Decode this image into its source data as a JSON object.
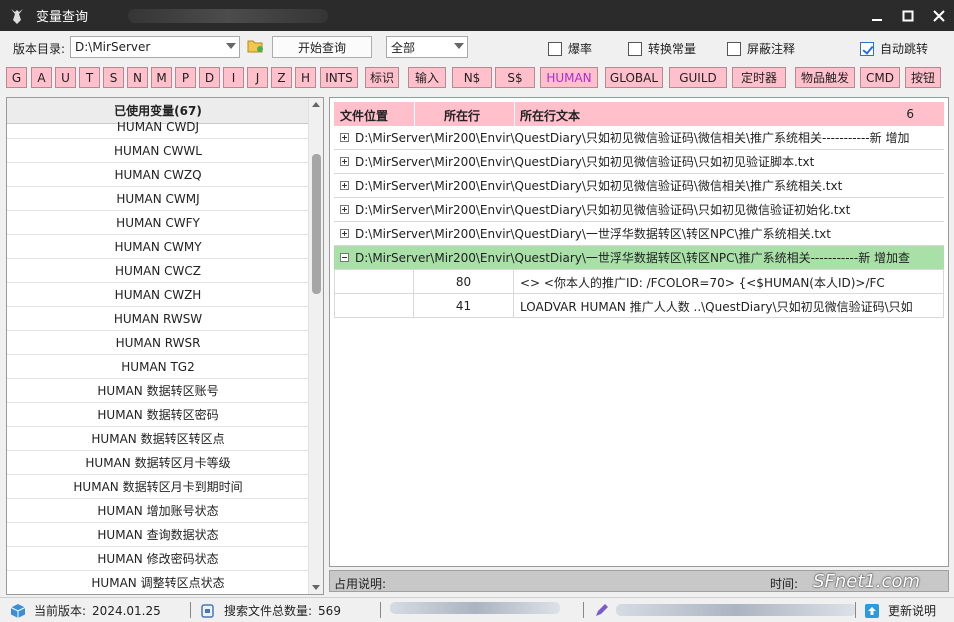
{
  "window": {
    "title": "变量查询"
  },
  "toolbar": {
    "dir_label": "版本目录:",
    "dir_value": "D:\\MirServer",
    "query_button": "开始查询",
    "scope_value": "全部",
    "checkboxes": [
      {
        "label": "爆率",
        "checked": false
      },
      {
        "label": "转换常量",
        "checked": false
      },
      {
        "label": "屏蔽注释",
        "checked": false
      },
      {
        "label": "自动跳转",
        "checked": true
      }
    ]
  },
  "var_buttons": [
    "G",
    "A",
    "U",
    "T",
    "S",
    "N",
    "M",
    "P",
    "D",
    "I",
    "J",
    "Z",
    "H",
    "INTS",
    "标识",
    "输入",
    "N$",
    "S$",
    "HUMAN",
    "GLOBAL",
    "GUILD",
    "定时器",
    "物品触发",
    "CMD",
    "按钮"
  ],
  "selected_var_button": "HUMAN",
  "left_panel": {
    "header": "已使用变量(67)",
    "items": [
      "HUMAN CWDJ",
      "HUMAN CWWL",
      "HUMAN CWZQ",
      "HUMAN CWMJ",
      "HUMAN CWFY",
      "HUMAN CWMY",
      "HUMAN CWCZ",
      "HUMAN CWZH",
      "HUMAN RWSW",
      "HUMAN RWSR",
      "HUMAN TG2",
      "HUMAN 数据转区账号",
      "HUMAN 数据转区密码",
      "HUMAN 数据转区转区点",
      "HUMAN 数据转区月卡等级",
      "HUMAN 数据转区月卡到期时间",
      "HUMAN 增加账号状态",
      "HUMAN 查询数据状态",
      "HUMAN 修改密码状态",
      "HUMAN 调整转区点状态"
    ]
  },
  "right_panel": {
    "col_file": "文件位置",
    "col_line": "所在行",
    "col_text": "所在行文本",
    "count": "6",
    "files": [
      {
        "path": "D:\\MirServer\\Mir200\\Envir\\QuestDiary\\只如初见微信验证码\\微信相关\\推广系统相关-----------新 增加",
        "expanded": false
      },
      {
        "path": "D:\\MirServer\\Mir200\\Envir\\QuestDiary\\只如初见微信验证码\\只如初见验证脚本.txt",
        "expanded": false
      },
      {
        "path": "D:\\MirServer\\Mir200\\Envir\\QuestDiary\\只如初见微信验证码\\微信相关\\推广系统相关.txt",
        "expanded": false
      },
      {
        "path": "D:\\MirServer\\Mir200\\Envir\\QuestDiary\\只如初见微信验证码\\只如初见微信验证初始化.txt",
        "expanded": false
      },
      {
        "path": "D:\\MirServer\\Mir200\\Envir\\QuestDiary\\一世浮华数据转区\\转区NPC\\推广系统相关.txt",
        "expanded": false
      },
      {
        "path": "D:\\MirServer\\Mir200\\Envir\\QuestDiary\\一世浮华数据转区\\转区NPC\\推广系统相关-----------新 增加查",
        "expanded": true
      }
    ],
    "sub_rows": [
      {
        "line": "80",
        "text": "<>          <你本人的推广ID: /FCOLOR=70>  {<$HUMAN(本人ID)>/FC"
      },
      {
        "line": "41",
        "text": "LOADVAR  HUMAN 推广人人数 ..\\QuestDiary\\只如初见微信验证码\\只如"
      }
    ]
  },
  "infobar": {
    "label": "占用说明:",
    "time_label": "时间:",
    "watermark": "SFnet1.com"
  },
  "statusbar": {
    "version_label": "当前版本:",
    "version_value": "2024.01.25",
    "files_label": "搜索文件总数量:",
    "files_value": "569",
    "update_label": "更新说明"
  }
}
